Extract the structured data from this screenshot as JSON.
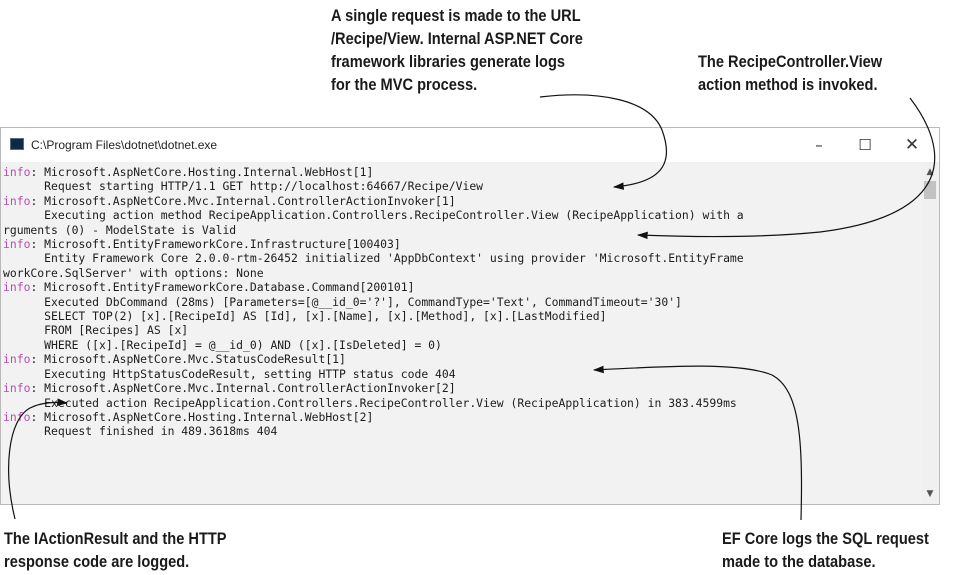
{
  "callouts": {
    "top": [
      "A single request is made to the URL",
      "/Recipe/View. Internal ASP.NET Core",
      "framework libraries generate logs",
      "for the MVC process."
    ],
    "right": [
      "The RecipeController.View",
      "action method is invoked."
    ],
    "bottom_left": [
      "The IActionResult and the HTTP",
      "response code are logged."
    ],
    "bottom_right": [
      "EF Core logs the SQL request",
      "made to the database."
    ]
  },
  "window": {
    "title": "C:\\Program Files\\dotnet\\dotnet.exe",
    "minimize": "–",
    "maximize": "☐",
    "close": "✕"
  },
  "scrollbar": {
    "up": "▲",
    "down": "▼"
  },
  "log_lines": [
    {
      "level": "info",
      "text": ": Microsoft.AspNetCore.Hosting.Internal.WebHost[1]"
    },
    {
      "level": "",
      "text": "      Request starting HTTP/1.1 GET http://localhost:64667/Recipe/View"
    },
    {
      "level": "info",
      "text": ": Microsoft.AspNetCore.Mvc.Internal.ControllerActionInvoker[1]"
    },
    {
      "level": "",
      "text": "      Executing action method RecipeApplication.Controllers.RecipeController.View (RecipeApplication) with a"
    },
    {
      "level": "",
      "text": "rguments (0) - ModelState is Valid"
    },
    {
      "level": "info",
      "text": ": Microsoft.EntityFrameworkCore.Infrastructure[100403]"
    },
    {
      "level": "",
      "text": "      Entity Framework Core 2.0.0-rtm-26452 initialized 'AppDbContext' using provider 'Microsoft.EntityFrame"
    },
    {
      "level": "",
      "text": "workCore.SqlServer' with options: None"
    },
    {
      "level": "info",
      "text": ": Microsoft.EntityFrameworkCore.Database.Command[200101]"
    },
    {
      "level": "",
      "text": "      Executed DbCommand (28ms) [Parameters=[@__id_0='?'], CommandType='Text', CommandTimeout='30']"
    },
    {
      "level": "",
      "text": "      SELECT TOP(2) [x].[RecipeId] AS [Id], [x].[Name], [x].[Method], [x].[LastModified]"
    },
    {
      "level": "",
      "text": "      FROM [Recipes] AS [x]"
    },
    {
      "level": "",
      "text": "      WHERE ([x].[RecipeId] = @__id_0) AND ([x].[IsDeleted] = 0)"
    },
    {
      "level": "info",
      "text": ": Microsoft.AspNetCore.Mvc.StatusCodeResult[1]"
    },
    {
      "level": "",
      "text": "      Executing HttpStatusCodeResult, setting HTTP status code 404"
    },
    {
      "level": "info",
      "text": ": Microsoft.AspNetCore.Mvc.Internal.ControllerActionInvoker[2]"
    },
    {
      "level": "",
      "text": "      Executed action RecipeApplication.Controllers.RecipeController.View (RecipeApplication) in 383.4599ms"
    },
    {
      "level": "info",
      "text": ": Microsoft.AspNetCore.Hosting.Internal.WebHost[2]"
    },
    {
      "level": "",
      "text": "      Request finished in 489.3618ms 404"
    }
  ],
  "colors": {
    "info_level": "#b64fb0",
    "console_bg": "#f2f2f2",
    "callout_text": "#1a1a1a"
  }
}
